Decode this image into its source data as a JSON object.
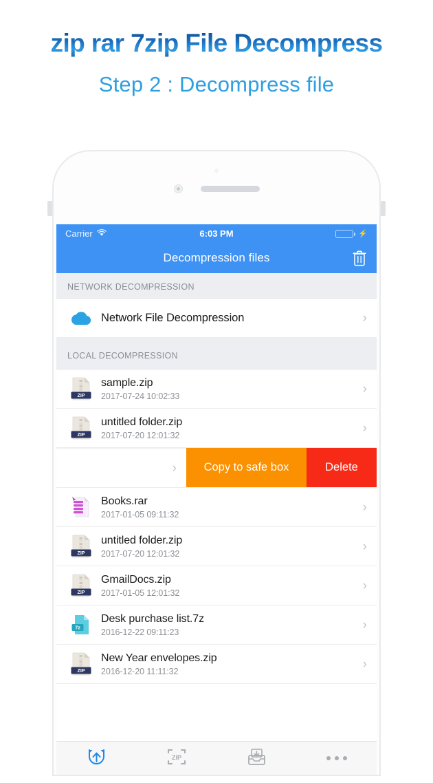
{
  "promo": {
    "title": "zip rar 7zip File Decompress",
    "subtitle": "Step 2 : Decompress file",
    "title_gradient_top": "#0b4e8f",
    "title_gradient_mid": "#2f9ae0",
    "subtitle_color": "#2f9fe0"
  },
  "status_bar": {
    "carrier": "Carrier",
    "wifi_icon": "wifi-icon",
    "time": "6:03 PM",
    "battery_icon": "battery-icon",
    "battery_color": "#3ddc5c",
    "charging_icon": "lightning-bolt-icon"
  },
  "nav_bar": {
    "title": "Decompression files",
    "background": "#3d92f4",
    "trash_icon": "trash-icon"
  },
  "sections": [
    {
      "header": "NETWORK DECOMPRESSION",
      "rows": [
        {
          "icon": "cloud-icon",
          "icon_color": "#29a3e3",
          "title": "Network File Decompression",
          "subtitle": "",
          "chevron": "›"
        }
      ]
    },
    {
      "header": "LOCAL DECOMPRESSION",
      "rows": [
        {
          "icon": "zip-file-icon",
          "icon_color": "#2c3763",
          "title": "sample.zip",
          "subtitle": "2017-07-24 10:02:33",
          "chevron": "›"
        },
        {
          "icon": "zip-file-icon",
          "icon_color": "#2c3763",
          "title": "untitled folder.zip",
          "subtitle": "2017-07-20 12:01:32",
          "chevron": "›"
        },
        {
          "icon": "rar-file-icon",
          "icon_color": "#c94fd1",
          "title": "Books.rar",
          "subtitle": "2017-01-05 09:11:32",
          "chevron": "›"
        },
        {
          "icon": "zip-file-icon",
          "icon_color": "#2c3763",
          "title": "untitled folder.zip",
          "subtitle": "2017-07-20 12:01:32",
          "chevron": "›"
        },
        {
          "icon": "zip-file-icon",
          "icon_color": "#2c3763",
          "title": "GmailDocs.zip",
          "subtitle": "2017-01-05 12:01:32",
          "chevron": "›"
        },
        {
          "icon": "sevenz-file-icon",
          "icon_color": "#62cfe0",
          "title": "Desk purchase list.7z",
          "subtitle": "2016-12-22 09:11:23",
          "chevron": "›"
        },
        {
          "icon": "zip-file-icon",
          "icon_color": "#2c3763",
          "title": "New Year envelopes.zip",
          "subtitle": "2016-12-20 11:11:32",
          "chevron": "›"
        }
      ]
    }
  ],
  "swipe_row": {
    "chevron": "›",
    "copy_label": "Copy to safe box",
    "copy_color": "#fb9000",
    "delete_label": "Delete",
    "delete_color": "#f72a18"
  },
  "tab_bar": [
    {
      "icon": "decompress-icon",
      "active": true,
      "color": "#1e87e8"
    },
    {
      "icon": "zip-icon",
      "active": false,
      "color": "#a9acb1"
    },
    {
      "icon": "archive-inbox-icon",
      "active": false,
      "color": "#a9acb1"
    },
    {
      "icon": "more-dots-icon",
      "active": false,
      "color": "#a9acb1"
    }
  ]
}
